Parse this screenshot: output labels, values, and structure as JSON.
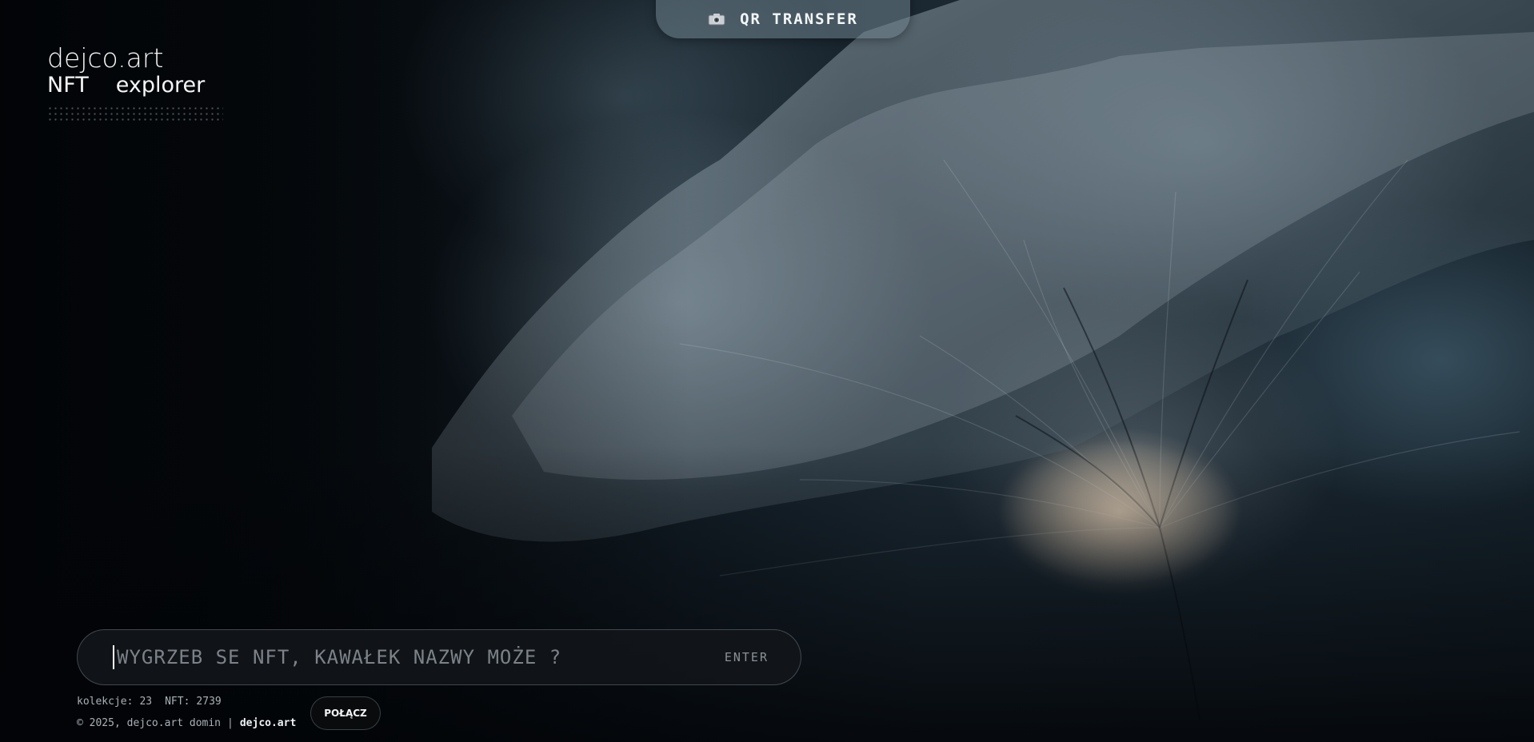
{
  "logo": {
    "line1": "dejco.art",
    "word_a": "NFT",
    "word_b": "explorer"
  },
  "topbar": {
    "qr_icon": "camera-icon",
    "qr_label": "QR TRANSFER"
  },
  "search": {
    "value": "",
    "placeholder": "WYGRZEB SE NFT, KAWAŁEK NAZWY MOŻE ?",
    "enter_label": "ENTER"
  },
  "stats": {
    "collections_label": "kolekcje:",
    "collections_value": "23",
    "nft_label": "NFT:",
    "nft_value": "2739"
  },
  "footer": {
    "copyright": "© 2025, dejco.art domin",
    "separator": "|",
    "link_text": "dejco.art",
    "connect_label": "POŁĄCZ"
  },
  "colors": {
    "background": "#05080c",
    "text_primary": "#f3f6f8",
    "text_muted": "#aab1b7",
    "pill_bg": "#6e828c",
    "search_bg": "#12161a",
    "glow": "#f5d7b4"
  }
}
